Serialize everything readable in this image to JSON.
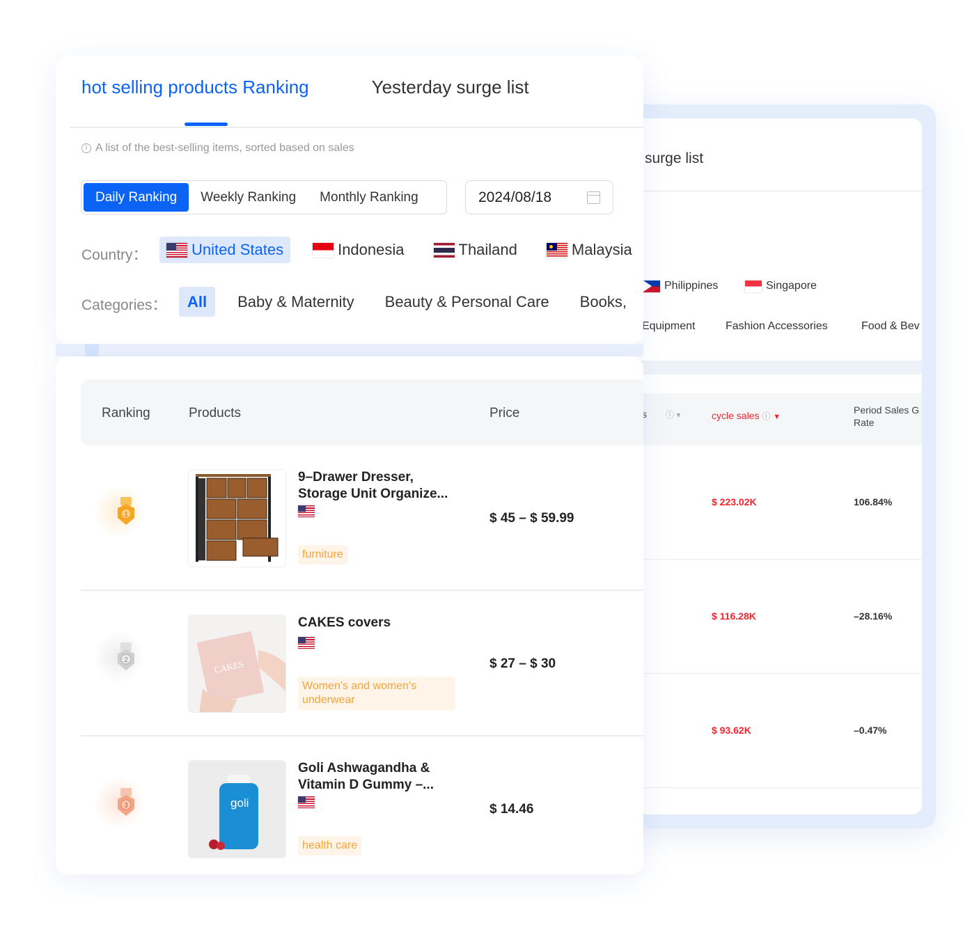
{
  "tabs": [
    {
      "label": "hot selling products Ranking",
      "active": true
    },
    {
      "label": "Yesterday surge list",
      "active": false
    }
  ],
  "hint": "A list of the best-selling items, sorted based on sales",
  "ranking_period": {
    "options": [
      "Daily Ranking",
      "Weekly Ranking",
      "Monthly Ranking"
    ],
    "selected": "Daily Ranking"
  },
  "date": "2024/08/18",
  "country": {
    "label": "Country：",
    "items": [
      {
        "name": "United States",
        "flag": "us",
        "active": true
      },
      {
        "name": "Indonesia",
        "flag": "id",
        "active": false
      },
      {
        "name": "Thailand",
        "flag": "th",
        "active": false
      },
      {
        "name": "Malaysia",
        "flag": "my",
        "active": false
      }
    ]
  },
  "categories": {
    "label": "Categories：",
    "items": [
      "All",
      "Baby & Maternity",
      "Beauty & Personal Care",
      "Books,"
    ],
    "selected": "All"
  },
  "table": {
    "headers": {
      "ranking": "Ranking",
      "products": "Products",
      "price": "Price"
    },
    "rows": [
      {
        "rank": 1,
        "medal": "gold",
        "name": "9–Drawer Dresser, Storage Unit Organize...",
        "flag": "us",
        "tag": "furniture",
        "price": "$ 45 – $ 59.99"
      },
      {
        "rank": 2,
        "medal": "silver",
        "name": "CAKES covers",
        "flag": "us",
        "tag": "Women's and women's underwear",
        "price": "$ 27 – $ 30"
      },
      {
        "rank": 3,
        "medal": "bronze",
        "name": "Goli Ashwagandha & Vitamin D Gummy –...",
        "flag": "us",
        "tag": "health care",
        "price": "$ 14.46"
      }
    ]
  },
  "back_panel": {
    "title": "surge list",
    "countries": [
      {
        "name": "Philippines",
        "flag": "ph"
      },
      {
        "name": "Singapore",
        "flag": "sg"
      }
    ],
    "categories": [
      "Equipment",
      "Fashion Accessories",
      "Food & Bev"
    ],
    "headers": {
      "partial": "s",
      "cycle_sales": "cycle sales",
      "growth_rate_line1": "Period Sales G",
      "growth_rate_line2": "Rate"
    },
    "rows": [
      {
        "cycle_sales": "$ 223.02K",
        "growth_rate": "106.84%"
      },
      {
        "cycle_sales": "$ 116.28K",
        "growth_rate": "–28.16%"
      },
      {
        "cycle_sales": "$ 93.62K",
        "growth_rate": "–0.47%"
      }
    ]
  },
  "colors": {
    "accent": "#0b63f6",
    "sales_red": "#f5222d",
    "tag_orange": "#f7a33a",
    "tag_bg": "#fff4e8",
    "chip_active_bg": "#dde8fb"
  }
}
